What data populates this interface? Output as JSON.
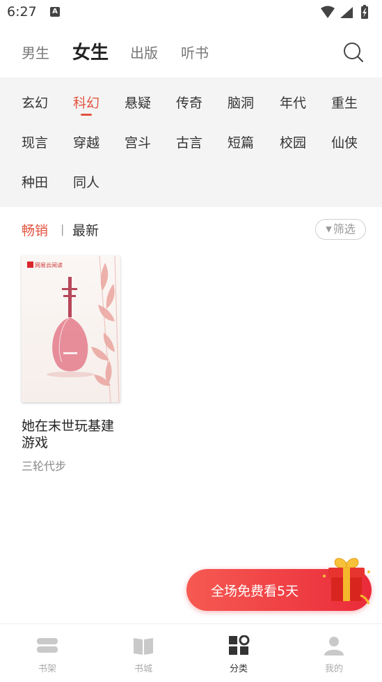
{
  "status_bar": {
    "time": "6:27",
    "notification_icon": "A"
  },
  "top_tabs": [
    {
      "label": "男生",
      "active": false
    },
    {
      "label": "女生",
      "active": true
    },
    {
      "label": "出版",
      "active": false
    },
    {
      "label": "听书",
      "active": false
    }
  ],
  "genres": [
    {
      "label": "玄幻",
      "active": false
    },
    {
      "label": "科幻",
      "active": true
    },
    {
      "label": "悬疑",
      "active": false
    },
    {
      "label": "传奇",
      "active": false
    },
    {
      "label": "脑洞",
      "active": false
    },
    {
      "label": "年代",
      "active": false
    },
    {
      "label": "重生",
      "active": false
    },
    {
      "label": "现言",
      "active": false
    },
    {
      "label": "穿越",
      "active": false
    },
    {
      "label": "宫斗",
      "active": false
    },
    {
      "label": "古言",
      "active": false
    },
    {
      "label": "短篇",
      "active": false
    },
    {
      "label": "校园",
      "active": false
    },
    {
      "label": "仙侠",
      "active": false
    },
    {
      "label": "种田",
      "active": false
    },
    {
      "label": "同人",
      "active": false
    }
  ],
  "sort": {
    "hot_label": "畅销",
    "separator": "|",
    "new_label": "最新",
    "filter_label": "筛选"
  },
  "books": [
    {
      "title": "她在末世玩基建游戏",
      "author": "三轮代步",
      "cover_brand": "网易云阅读"
    }
  ],
  "promo": {
    "label": "全场免费看5天"
  },
  "bottom_nav": [
    {
      "label": "书架",
      "icon": "bookshelf-icon",
      "active": false
    },
    {
      "label": "书城",
      "icon": "book-open-icon",
      "active": false
    },
    {
      "label": "分类",
      "icon": "category-grid-icon",
      "active": true
    },
    {
      "label": "我的",
      "icon": "profile-icon",
      "active": false
    }
  ],
  "colors": {
    "accent": "#e2533f",
    "promo": "#ef3f45",
    "panel_bg": "#f4f4f4"
  }
}
